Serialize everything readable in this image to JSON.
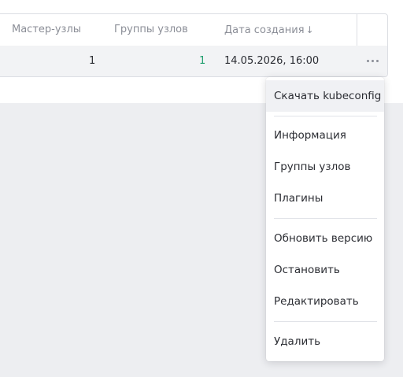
{
  "table": {
    "columns": [
      {
        "label": "Мастер-узлы"
      },
      {
        "label": "Группы узлов"
      },
      {
        "label": "Дата создания"
      }
    ],
    "sort_indicator": "↓",
    "row": {
      "master_nodes": "1",
      "node_groups": "1",
      "created_at": "14.05.2026, 16:00"
    },
    "row_actions_icon": "more-horizontal-icon"
  },
  "menu": {
    "items": [
      {
        "label": "Скачать kubeconfig",
        "hovered": true
      },
      {
        "label": "Информация"
      },
      {
        "label": "Группы узлов"
      },
      {
        "label": "Плагины"
      },
      {
        "label": "Обновить версию"
      },
      {
        "label": "Остановить"
      },
      {
        "label": "Редактировать"
      },
      {
        "label": "Удалить"
      }
    ]
  },
  "colors": {
    "accent_green": "#1f9e6e",
    "row_bg": "#f2f3f5",
    "page_bg": "#edeef1"
  }
}
